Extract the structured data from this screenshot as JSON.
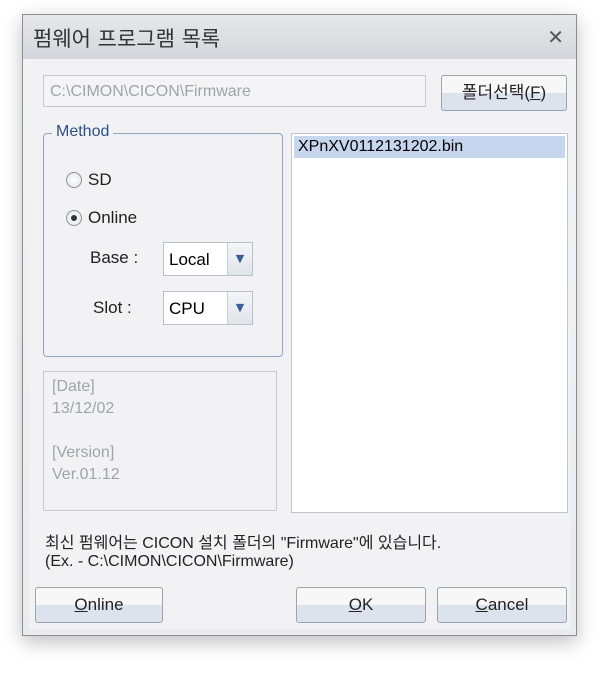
{
  "window": {
    "title": "펌웨어 프로그램 목록",
    "close_icon": "close-icon"
  },
  "path": {
    "value": "C:\\CIMON\\CICON\\Firmware"
  },
  "folder_button": {
    "label": "폴더선택(",
    "key": "F",
    ")": ")",
    "suffix": ")"
  },
  "method": {
    "legend": "Method",
    "sd": "SD",
    "online": "Online",
    "selected": "Online",
    "base_label": "Base :",
    "base_value": "Local",
    "slot_label": "Slot :",
    "slot_value": "CPU"
  },
  "info": {
    "date_label": "[Date]",
    "date": "13/12/02",
    "version_label": "[Version]",
    "version": "Ver.01.12"
  },
  "files": [
    "XPnXV0112131202.bin"
  ],
  "note": {
    "line1": "최신 펌웨어는 CICON 설치 폴더의 \"Firmware\"에 있습니다.",
    "line2": "(Ex. - C:\\CIMON\\CICON\\Firmware)"
  },
  "buttons": {
    "online": "Online",
    "ok": "OK",
    "cancel": "Cancel"
  }
}
